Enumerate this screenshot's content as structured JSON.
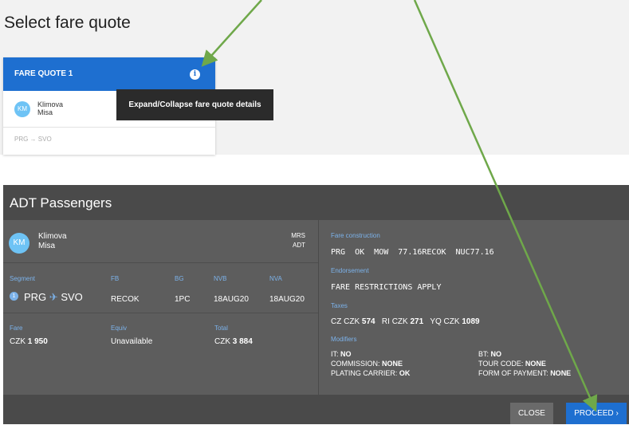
{
  "top": {
    "title": "Select fare quote",
    "card": {
      "header": "FARE QUOTE 1",
      "avatar": "KM",
      "last_name": "Klimova",
      "first_name": "Misa",
      "route": "PRG → SVO"
    },
    "tooltip": "Expand/Collapse fare quote details"
  },
  "panel": {
    "title": "ADT Passengers",
    "passenger": {
      "avatar": "KM",
      "last_name": "Klimova",
      "first_name": "Misa",
      "title": "MRS",
      "type": "ADT"
    },
    "segment": {
      "labels": {
        "segment": "Segment",
        "fb": "FB",
        "bg": "BG",
        "nvb": "NVB",
        "nva": "NVA"
      },
      "number": "1",
      "from": "PRG",
      "to": "SVO",
      "plane": "✈",
      "fb": "RECOK",
      "bg": "1PC",
      "nvb": "18AUG20",
      "nva": "18AUG20"
    },
    "fare": {
      "labels": {
        "fare": "Fare",
        "equiv": "Equiv",
        "total": "Total"
      },
      "fare_currency": "CZK",
      "fare_amount": "1 950",
      "equiv": "Unavailable",
      "total_currency": "CZK",
      "total_amount": "3 884"
    },
    "right": {
      "fare_construction_label": "Fare construction",
      "fare_construction": "PRG  OK  MOW  77.16RECOK  NUC77.16",
      "endorsement_label": "Endorsement",
      "endorsement": "FARE RESTRICTIONS APPLY",
      "taxes_label": "Taxes",
      "taxes": [
        {
          "currency": "CZ CZK",
          "amount": "574"
        },
        {
          "currency": "RI CZK",
          "amount": "271"
        },
        {
          "currency": "YQ CZK",
          "amount": "1089"
        }
      ],
      "modifiers_label": "Modifiers",
      "modifiers": {
        "it_label": "IT:",
        "it": "NO",
        "bt_label": "BT:",
        "bt": "NO",
        "commission_label": "COMMISSION:",
        "commission": "NONE",
        "tour_code_label": "TOUR CODE:",
        "tour_code": "NONE",
        "plating_label": "PLATING CARRIER:",
        "plating": "OK",
        "fop_label": "FORM OF PAYMENT:",
        "fop": "NONE"
      }
    },
    "footer": {
      "close": "CLOSE",
      "proceed": "PROCEED",
      "proceed_icon": "chevron-right-icon"
    }
  },
  "colors": {
    "brand_blue": "#1e6fd0",
    "panel_bg": "#5d5d5d",
    "panel_dark": "#4a4a4a",
    "label_blue": "#7cb2ea",
    "avatar": "#6ec3f5",
    "annotation_arrow": "#6fa84a"
  }
}
